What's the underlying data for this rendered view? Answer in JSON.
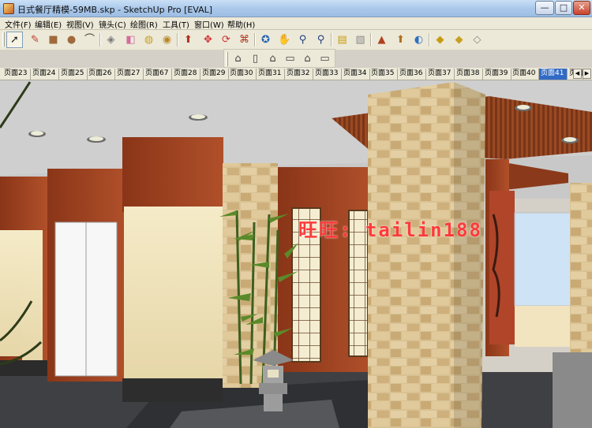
{
  "window": {
    "title": "日式餐厅精模-59MB.skp - SketchUp Pro [EVAL]",
    "controls": {
      "minimize": "—",
      "maximize": "□",
      "close": "✕"
    }
  },
  "menu": [
    {
      "label": "文件(F)"
    },
    {
      "label": "编辑(E)"
    },
    {
      "label": "视图(V)"
    },
    {
      "label": "镜头(C)"
    },
    {
      "label": "绘图(R)"
    },
    {
      "label": "工具(T)"
    },
    {
      "label": "窗口(W)"
    },
    {
      "label": "帮助(H)"
    }
  ],
  "toolbar1": [
    {
      "name": "select-icon",
      "glyph": "➚",
      "color": "#222222",
      "active": true
    },
    {
      "name": "pencil-icon",
      "glyph": "✎",
      "color": "#c0392b"
    },
    {
      "name": "rectangle-icon",
      "glyph": "■",
      "color": "#a06a3c"
    },
    {
      "name": "circle-icon",
      "glyph": "●",
      "color": "#a06a3c"
    },
    {
      "name": "arc-icon",
      "glyph": "⌒",
      "color": "#333333"
    },
    {
      "name": "make-component-icon",
      "glyph": "◈",
      "color": "#7a7a7a"
    },
    {
      "name": "eraser-icon",
      "glyph": "◧",
      "color": "#d46aa0"
    },
    {
      "name": "tape-measure-icon",
      "glyph": "◍",
      "color": "#c8a020"
    },
    {
      "name": "paint-bucket-icon",
      "glyph": "◉",
      "color": "#b8862a"
    },
    {
      "name": "push-pull-icon",
      "glyph": "⬆",
      "color": "#b03020"
    },
    {
      "name": "move-icon",
      "glyph": "✥",
      "color": "#d03030"
    },
    {
      "name": "rotate-icon",
      "glyph": "⟳",
      "color": "#d03030"
    },
    {
      "name": "offset-icon",
      "glyph": "⌘",
      "color": "#b03020"
    },
    {
      "name": "orbit-icon",
      "glyph": "✪",
      "color": "#2060b0"
    },
    {
      "name": "pan-icon",
      "glyph": "✋",
      "color": "#444444"
    },
    {
      "name": "zoom-icon",
      "glyph": "⚲",
      "color": "#204080"
    },
    {
      "name": "zoom-extents-icon",
      "glyph": "⚲",
      "color": "#204080"
    },
    {
      "name": "add-location-icon",
      "glyph": "▤",
      "color": "#c89a10"
    },
    {
      "name": "toggle-terrain-icon",
      "glyph": "▧",
      "color": "#888888"
    },
    {
      "name": "get-models-icon",
      "glyph": "▲",
      "color": "#b04020"
    },
    {
      "name": "share-model-icon",
      "glyph": "⬆",
      "color": "#b07020"
    },
    {
      "name": "google-earth-icon",
      "glyph": "◐",
      "color": "#3070c0"
    },
    {
      "name": "components-icon",
      "glyph": "◆",
      "color": "#c89a10"
    },
    {
      "name": "styles-icon",
      "glyph": "◆",
      "color": "#c8a020"
    },
    {
      "name": "share-component-icon",
      "glyph": "◇",
      "color": "#888888"
    }
  ],
  "toolbar2": [
    {
      "name": "iso-view-icon",
      "glyph": "⌂"
    },
    {
      "name": "top-view-icon",
      "glyph": "▯"
    },
    {
      "name": "front-view-icon",
      "glyph": "⌂"
    },
    {
      "name": "right-view-icon",
      "glyph": "▭"
    },
    {
      "name": "back-view-icon",
      "glyph": "⌂"
    },
    {
      "name": "left-view-icon",
      "glyph": "▭"
    }
  ],
  "scene_tabs": [
    {
      "label": "页面23"
    },
    {
      "label": "页面24"
    },
    {
      "label": "页面25"
    },
    {
      "label": "页面26"
    },
    {
      "label": "页面27"
    },
    {
      "label": "页面67"
    },
    {
      "label": "页面28"
    },
    {
      "label": "页面29"
    },
    {
      "label": "页面30"
    },
    {
      "label": "页面31"
    },
    {
      "label": "页面32"
    },
    {
      "label": "页面33"
    },
    {
      "label": "页面34"
    },
    {
      "label": "页面35"
    },
    {
      "label": "页面36"
    },
    {
      "label": "页面37"
    },
    {
      "label": "页面38"
    },
    {
      "label": "页面39"
    },
    {
      "label": "页面40"
    },
    {
      "label": "页面41",
      "active": true
    },
    {
      "label": "页面"
    }
  ],
  "tab_nav": {
    "prev": "◀",
    "next": "▶"
  },
  "viewport": {
    "watermark": "旺旺: tailin188",
    "colors": {
      "ceiling": "#c9c9c9",
      "wood": "#9a3f1e",
      "stone": "#d8c08e",
      "shoji": "#f2ead0",
      "floor": "#3f3f41",
      "sky": "#cfe3f6"
    }
  }
}
